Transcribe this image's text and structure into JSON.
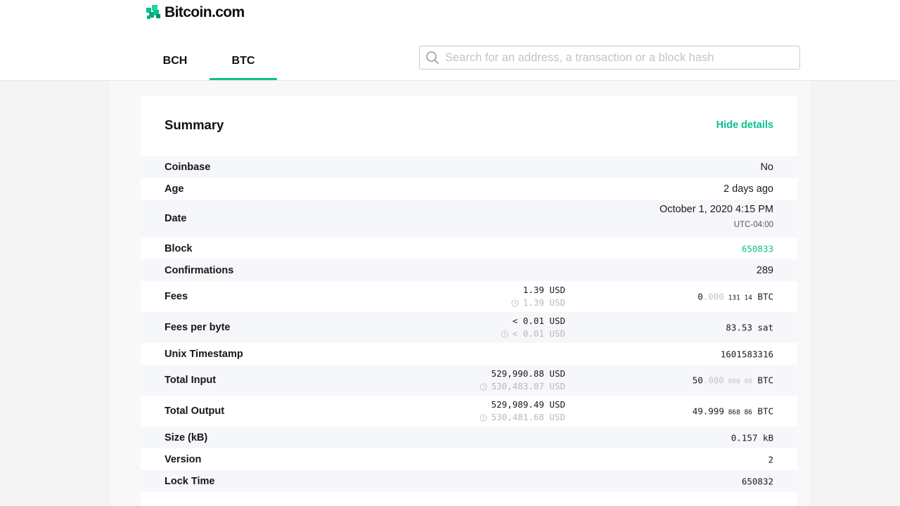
{
  "header": {
    "logo_text": "Bitcoin.com",
    "tabs": [
      {
        "label": "BCH",
        "active": false
      },
      {
        "label": "BTC",
        "active": true
      }
    ],
    "search": {
      "placeholder": "Search for an address, a transaction or a block hash",
      "value": ""
    }
  },
  "colors": {
    "accent": "#0ac18e"
  },
  "summary": {
    "title": "Summary",
    "hide_details_label": "Hide details",
    "rows": {
      "coinbase": {
        "label": "Coinbase",
        "value": "No"
      },
      "age": {
        "label": "Age",
        "value": "2 days ago"
      },
      "date": {
        "label": "Date",
        "value": "October 1, 2020 4:15 PM",
        "timezone": "UTC-04:00"
      },
      "block": {
        "label": "Block",
        "value": "650833"
      },
      "confirmations": {
        "label": "Confirmations",
        "value": "289"
      },
      "fees": {
        "label": "Fees",
        "usd_now": "1.39",
        "usd_then": "1.39",
        "usd_unit": "USD",
        "btc_main": "0",
        "btc_dim": ".000",
        "btc_small": " 131 14",
        "btc_unit": "BTC"
      },
      "fees_per_byte": {
        "label": "Fees per byte",
        "usd_now": "< 0.01",
        "usd_then": "< 0.01",
        "usd_unit": "USD",
        "value": "83.53 sat"
      },
      "unix_timestamp": {
        "label": "Unix Timestamp",
        "value": "1601583316"
      },
      "total_input": {
        "label": "Total Input",
        "usd_now": "529,990.88",
        "usd_then": "530,483.07",
        "usd_unit": "USD",
        "btc_main": "50",
        "btc_dim": ".000",
        "btc_small": " 000 00",
        "btc_unit": "BTC"
      },
      "total_output": {
        "label": "Total Output",
        "usd_now": "529,989.49",
        "usd_then": "530,481.68",
        "usd_unit": "USD",
        "btc_main": "49.999",
        "btc_dim": "",
        "btc_small": " 868 86",
        "btc_unit": "BTC"
      },
      "size": {
        "label": "Size (kB)",
        "value": "0.157 kB"
      },
      "version": {
        "label": "Version",
        "value": "2"
      },
      "lock_time": {
        "label": "Lock Time",
        "value": "650832"
      }
    }
  }
}
